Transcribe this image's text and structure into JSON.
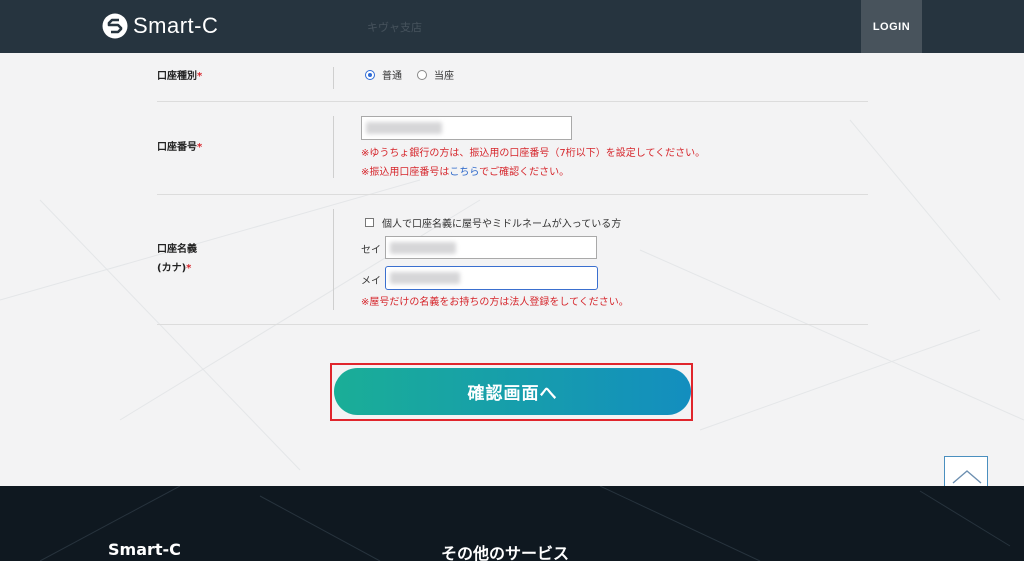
{
  "header": {
    "logo_text": "Smart-C",
    "ghost_text": "キヴャ支店",
    "login_label": "LOGIN"
  },
  "form": {
    "account_type": {
      "label": "口座種別",
      "required_mark": "*",
      "options": [
        {
          "label": "普通",
          "selected": true
        },
        {
          "label": "当座",
          "selected": false
        }
      ]
    },
    "account_number": {
      "label": "口座番号",
      "required_mark": "*",
      "note1": "※ゆうちょ銀行の方は、振込用の口座番号（7桁以下）を設定してください。",
      "note2_before": "※振込用口座番号は",
      "note2_link": "こちら",
      "note2_after": "でご確認ください。"
    },
    "account_name": {
      "label_line1": "口座名義",
      "label_line2": "(カナ)",
      "required_mark": "*",
      "checkbox_label": "個人で口座名義に屋号やミドルネームが入っている方",
      "sei_label": "セイ",
      "mei_label": "メイ",
      "note": "※屋号だけの名義をお持ちの方は法人登録をしてください。"
    }
  },
  "confirm_label": "確認画面へ",
  "footer": {
    "brand": "Smart-C",
    "other_services": "その他のサービス"
  },
  "colors": {
    "header_bg": "#26343f",
    "required": "#d8262c",
    "button_start": "#1aae97",
    "button_end": "#138ebf",
    "highlight": "#e0252c"
  }
}
